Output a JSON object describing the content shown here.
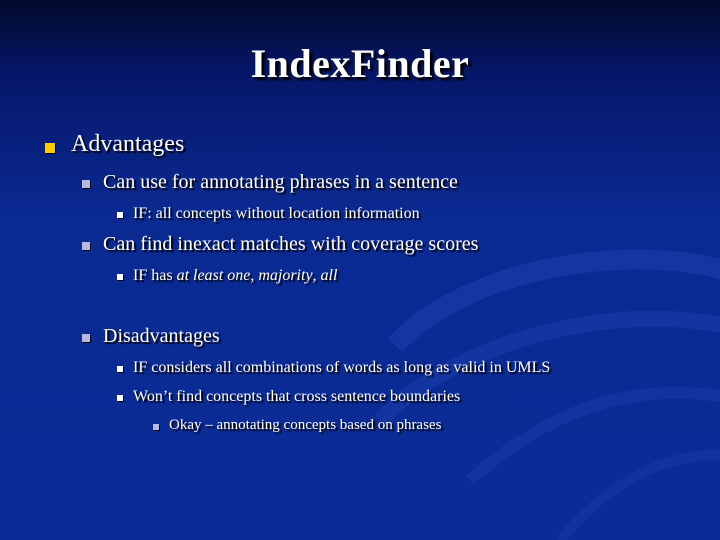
{
  "slide": {
    "title": "IndexFinder",
    "items": [
      {
        "level": 1,
        "text": "Advantages"
      },
      {
        "level": 2,
        "text": "Can use for annotating phrases in a sentence"
      },
      {
        "level": 3,
        "text": "IF: all concepts without location information"
      },
      {
        "level": 2,
        "text": "Can find inexact matches with coverage scores"
      },
      {
        "level": 3,
        "text_prefix": "IF has ",
        "em1": "at least one",
        "sep1": ", ",
        "em2": "majority",
        "sep2": ", ",
        "em3": "all"
      },
      {
        "level": 2,
        "text": "Disadvantages"
      },
      {
        "level": 3,
        "text": "IF considers all combinations of words as long as valid in UMLS"
      },
      {
        "level": 3,
        "text": "Won’t find concepts that cross sentence boundaries"
      },
      {
        "level": 4,
        "text": "Okay – annotating concepts based on phrases"
      }
    ]
  },
  "colors": {
    "background_top": "#020a2c",
    "background_main": "#0b2c97",
    "bullet_level1": "#ffcc00",
    "bullet_level2": "#b8b8e8",
    "text": "#ffffff"
  }
}
